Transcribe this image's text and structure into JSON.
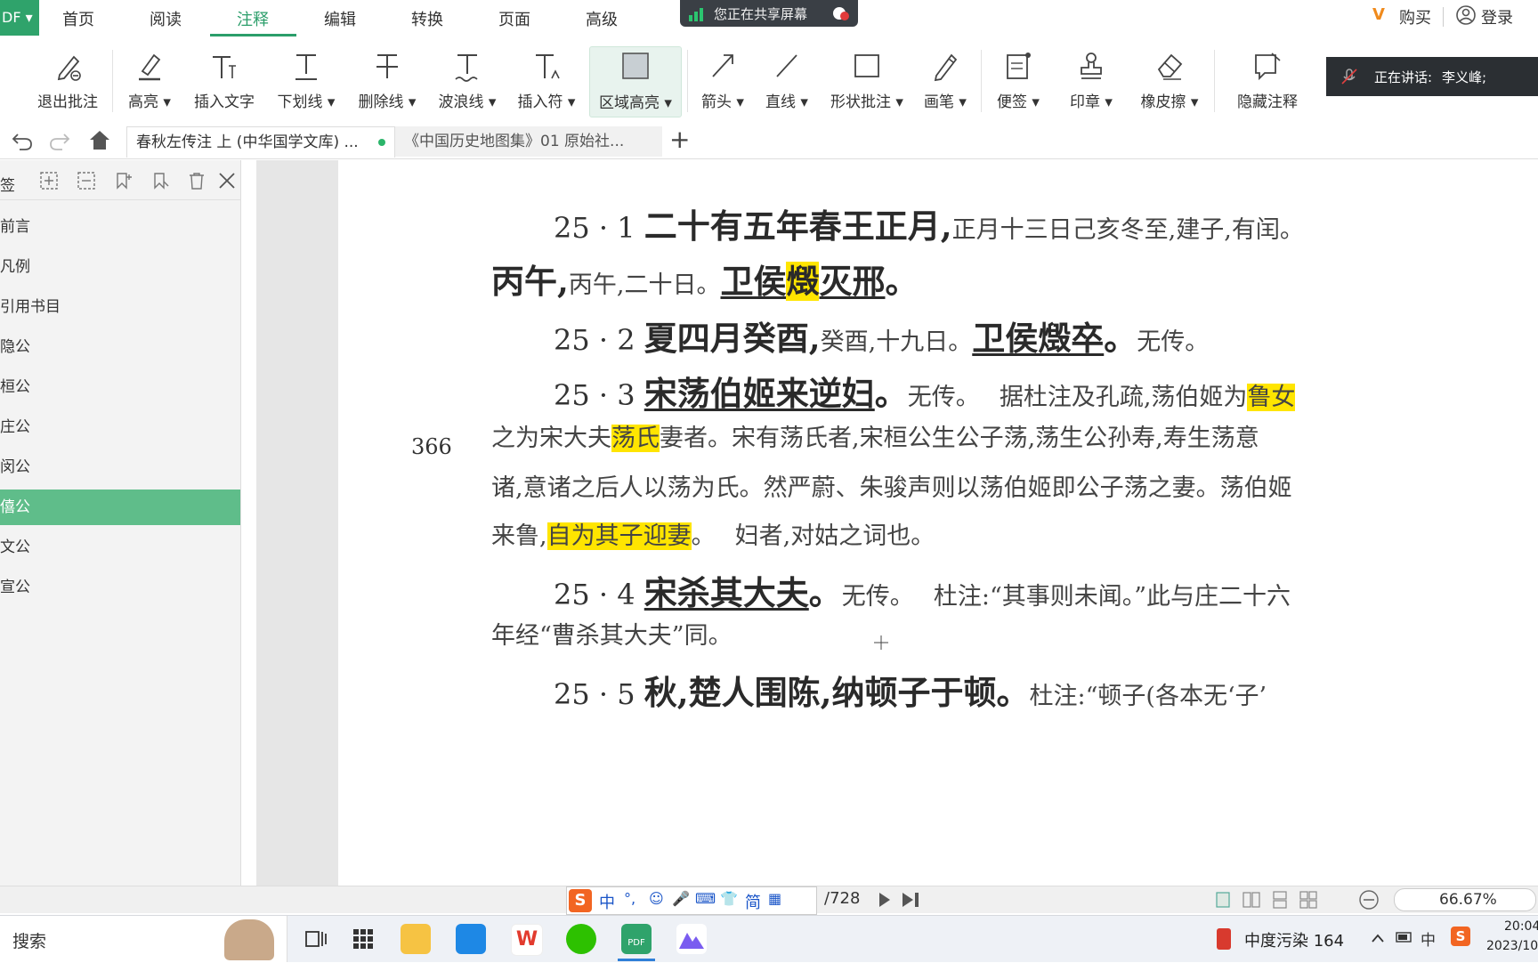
{
  "ribbon": {
    "app_badge": "DF ▾",
    "tabs": [
      "首页",
      "阅读",
      "注释",
      "编辑",
      "转换",
      "页面",
      "高级"
    ],
    "active_tab": "注释",
    "share_notice": "您正在共享屏幕",
    "buy": "购买",
    "login": "登录"
  },
  "toolbar": {
    "items": [
      "退出批注",
      "高亮 ▾",
      "插入文字",
      "下划线 ▾",
      "删除线 ▾",
      "波浪线 ▾",
      "插入符 ▾",
      "区域高亮 ▾",
      "箭头 ▾",
      "直线 ▾",
      "形状批注 ▾",
      "画笔 ▾",
      "便签 ▾",
      "印章 ▾",
      "橡皮擦 ▾",
      "隐藏注释"
    ],
    "speaking_label": "正在讲话:",
    "speaking_name": "李义峰;"
  },
  "doc_tabs": {
    "tab1": "春秋左传注 上 (中华国学文库) ...",
    "tab2": "《中国历史地图集》01 原始社...",
    "add": "+"
  },
  "sidebar": {
    "title": "签",
    "items": [
      "前言",
      "凡例",
      "引用书目",
      "隐公",
      "桓公",
      "庄公",
      "闵公",
      "僖公",
      "文公",
      "宣公"
    ],
    "selected": "僖公"
  },
  "document": {
    "page_number": "366",
    "l1": {
      "num": "25 · 1 ",
      "big": "二十有五年春王正月,",
      "small": "正月十三日己亥冬至,建子,有闰。"
    },
    "l2": {
      "big_a": "丙午,",
      "small": "丙午,二十日。",
      "big_b": "卫侯",
      "hl": "燬",
      "big_c": "灭邢",
      "end": "。"
    },
    "l3": {
      "num": "25 · 2 ",
      "big": "夏四月癸酉,",
      "small": "癸酉,十九日。",
      "big_b": "卫侯燬卒",
      "end": "。",
      "small_b": "无传。"
    },
    "l4": {
      "num": "25 · 3 ",
      "big": "宋荡伯姬来逆妇",
      "end": "。",
      "small": "无传。　 据杜注及孔疏,荡伯姬为",
      "hl": "鲁女"
    },
    "l5": {
      "a": "之为宋大夫",
      "hl": "荡氏",
      "b": "妻者。宋有荡氏者,宋桓公生公子荡,荡生公孙寿,寿生荡意"
    },
    "l6": {
      "a": "诸,意诸之后人以荡为氏。然严蔚、朱骏声则以荡伯姬即公子荡之妻。荡伯姬"
    },
    "l7": {
      "a": "来鲁,",
      "hl": "自为其子迎妻",
      "b": "。　 妇者,对姑之词也。"
    },
    "l8": {
      "num": "25 · 4 ",
      "big": "宋杀其大夫",
      "end": "。",
      "small": "无传。　 杜注:“其事则未闻。”此与庄二十六"
    },
    "l9": {
      "a": "年经“曹杀其大夫”同。"
    },
    "l10": {
      "num": "25 · 5 ",
      "big": "秋,楚人围陈,纳顿子于顿",
      "end": "。",
      "small": "杜注:“顿子(各本无‘子’"
    }
  },
  "statusbar": {
    "ime": [
      "中",
      "°,",
      "☺",
      "🎤",
      "⌨",
      "👕",
      "简",
      "▦"
    ],
    "page_total": "/728",
    "zoom": "66.67%"
  },
  "taskbar": {
    "search": "搜索",
    "weather": "中度污染 164",
    "lang": "中",
    "time": "20:04",
    "date": "2023/10"
  }
}
